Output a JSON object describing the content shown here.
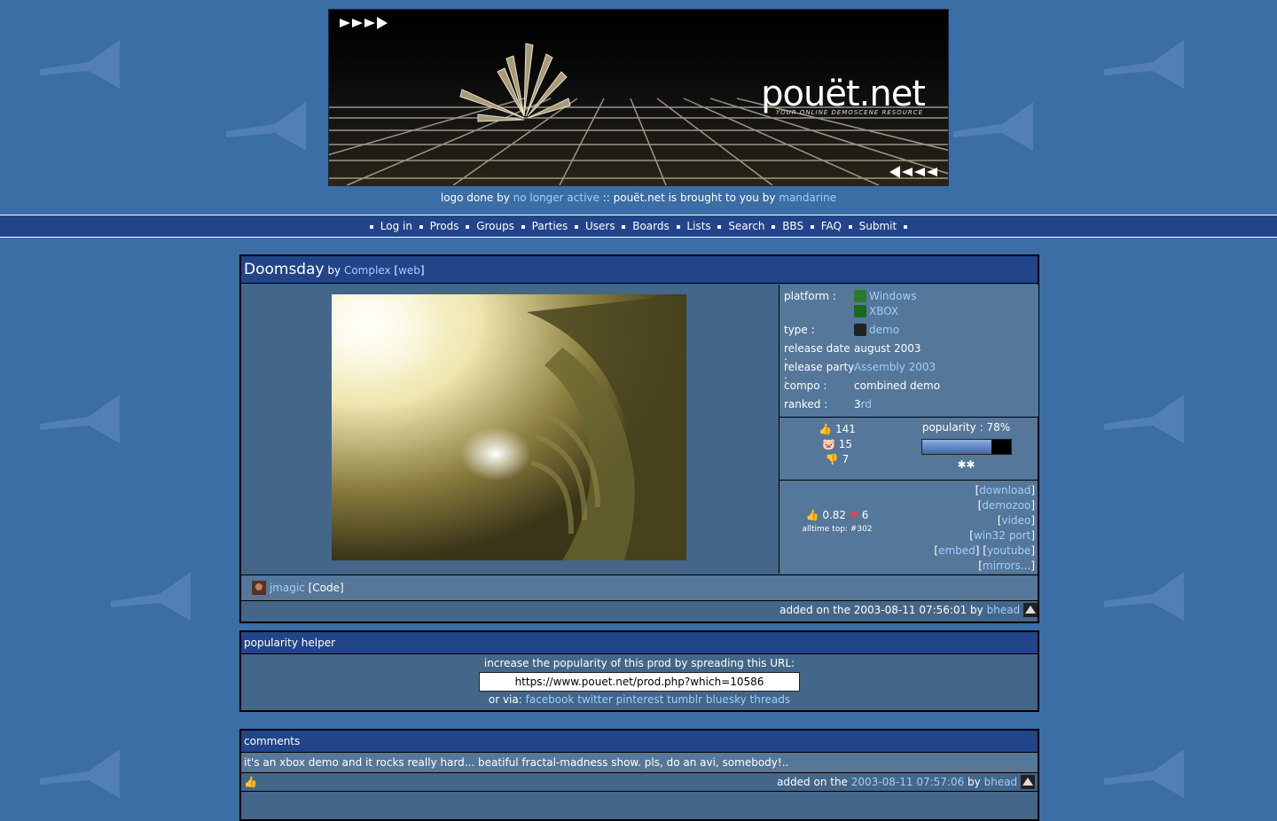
{
  "header": {
    "logo_title": "pouët.net",
    "logo_subtitle": "YOUR ONLINE DEMOSCENE RESOURCE",
    "credit_prefix": "logo done by",
    "credit_author": "no longer active",
    "credit_middle": ":: pouët.net is brought to you by",
    "credit_host": "mandarine"
  },
  "nav": {
    "items": [
      "Log in",
      "Prods",
      "Groups",
      "Parties",
      "Users",
      "Boards",
      "Lists",
      "Search",
      "BBS",
      "FAQ",
      "Submit"
    ]
  },
  "prod": {
    "title": "Doomsday",
    "by": "by",
    "group": "Complex",
    "web_link": "web",
    "info": {
      "platform_label": "platform :",
      "platforms": [
        "Windows",
        "XBOX"
      ],
      "type_label": "type :",
      "type": "demo",
      "release_date_label": "release date :",
      "release_date": "august 2003",
      "release_party_label": "release party :",
      "release_party": "Assembly 2003",
      "compo_label": "compo :",
      "compo": "combined demo",
      "ranked_label": "ranked :",
      "rank": "3",
      "rank_suffix": "rd"
    },
    "votes": {
      "up": "141",
      "piggie": "15",
      "down": "7"
    },
    "popularity": {
      "label": "popularity : 78%",
      "value": 0.78
    },
    "average": {
      "score": "0.82",
      "cdcs": "6",
      "alltime": "alltime top: #302"
    },
    "links": [
      "download",
      "demozoo",
      "video",
      "win32 port",
      "embed",
      "youtube",
      "mirrors..."
    ],
    "credits": {
      "user": "jmagic",
      "role": "[Code]"
    },
    "added": {
      "prefix": "added on the 2003-08-11 07:56:01 by",
      "user": "bhead"
    }
  },
  "helper": {
    "title": "popularity helper",
    "text": "increase the popularity of this prod by spreading this URL:",
    "url": "https://www.pouet.net/prod.php?which=10586",
    "via": "or via:",
    "shares": [
      "facebook",
      "twitter",
      "pinterest",
      "tumblr",
      "bluesky",
      "threads"
    ]
  },
  "comments": {
    "title": "comments",
    "items": [
      {
        "text": "it's an xbox demo and it rocks really hard... beatiful fractal-madness show. pls, do an avi, somebody!..",
        "added_prefix": "added on the",
        "date": "2003-08-11 07:57:06",
        "by": "by",
        "user": "bhead"
      }
    ]
  },
  "colors": {
    "page_bg": "#3a6ea5",
    "header_bar": "#224488",
    "panel": "#446688",
    "panel_light": "#557799",
    "link": "#9fcfff"
  }
}
